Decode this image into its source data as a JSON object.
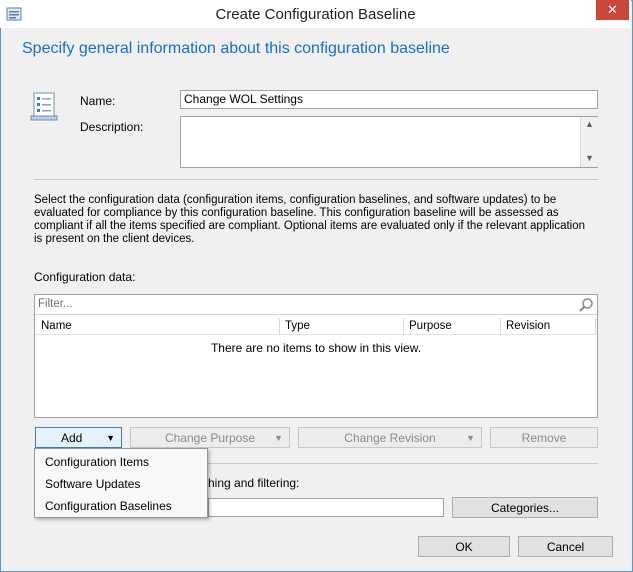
{
  "window": {
    "title": "Create Configuration Baseline",
    "close_glyph": "✕"
  },
  "header": {
    "heading": "Specify general information about this configuration baseline"
  },
  "form": {
    "name_label": "Name:",
    "name_value": "Change WOL Settings",
    "description_label": "Description:",
    "description_value": ""
  },
  "info_text": "Select the configuration data (configuration items, configuration baselines, and software updates) to be evaluated for compliance by this configuration baseline. This configuration baseline will be assessed as compliant if all the items specified are compliant. Optional items are evaluated only if the relevant application is present on  the client devices.",
  "config_data": {
    "label": "Configuration data:",
    "filter_placeholder": "Filter...",
    "columns": [
      "Name",
      "Type",
      "Purpose",
      "Revision"
    ],
    "empty_text": "There are no items to show in this view."
  },
  "buttons": {
    "add": "Add",
    "change_purpose": "Change Purpose",
    "change_revision": "Change Revision",
    "remove": "Remove",
    "categories": "Categories...",
    "ok": "OK",
    "cancel": "Cancel"
  },
  "categories_label_partial": "hing and filtering:",
  "add_menu": {
    "items": [
      "Configuration Items",
      "Software Updates",
      "Configuration Baselines"
    ]
  }
}
